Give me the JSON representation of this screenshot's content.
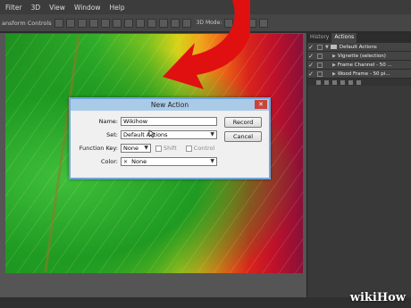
{
  "menu": {
    "items": [
      "Filter",
      "3D",
      "View",
      "Window",
      "Help"
    ]
  },
  "options_bar": {
    "controls_label": "ansform Controls",
    "mode_label": "3D Mode:"
  },
  "panel": {
    "tabs": [
      "History",
      "Actions"
    ],
    "rows": [
      {
        "label": "Default Actions",
        "kind": "set"
      },
      {
        "label": "Vignette (selection)",
        "kind": "action"
      },
      {
        "label": "Frame Channel - 50 ...",
        "kind": "action"
      },
      {
        "label": "Wood Frame - 50 pi...",
        "kind": "action"
      }
    ]
  },
  "dialog": {
    "title": "New Action",
    "name_label": "Name:",
    "name_value": "Wikihow",
    "set_label": "Set:",
    "set_value": "Default Actions",
    "fkey_label": "Function Key:",
    "fkey_value": "None",
    "shift_label": "Shift",
    "control_label": "Control",
    "color_label": "Color:",
    "color_value": "None",
    "record_button": "Record",
    "cancel_button": "Cancel"
  },
  "colors": {
    "arrow": "#e01010",
    "dialog_border": "#6ea6d8"
  },
  "logo": {
    "text": "wikiHow"
  }
}
